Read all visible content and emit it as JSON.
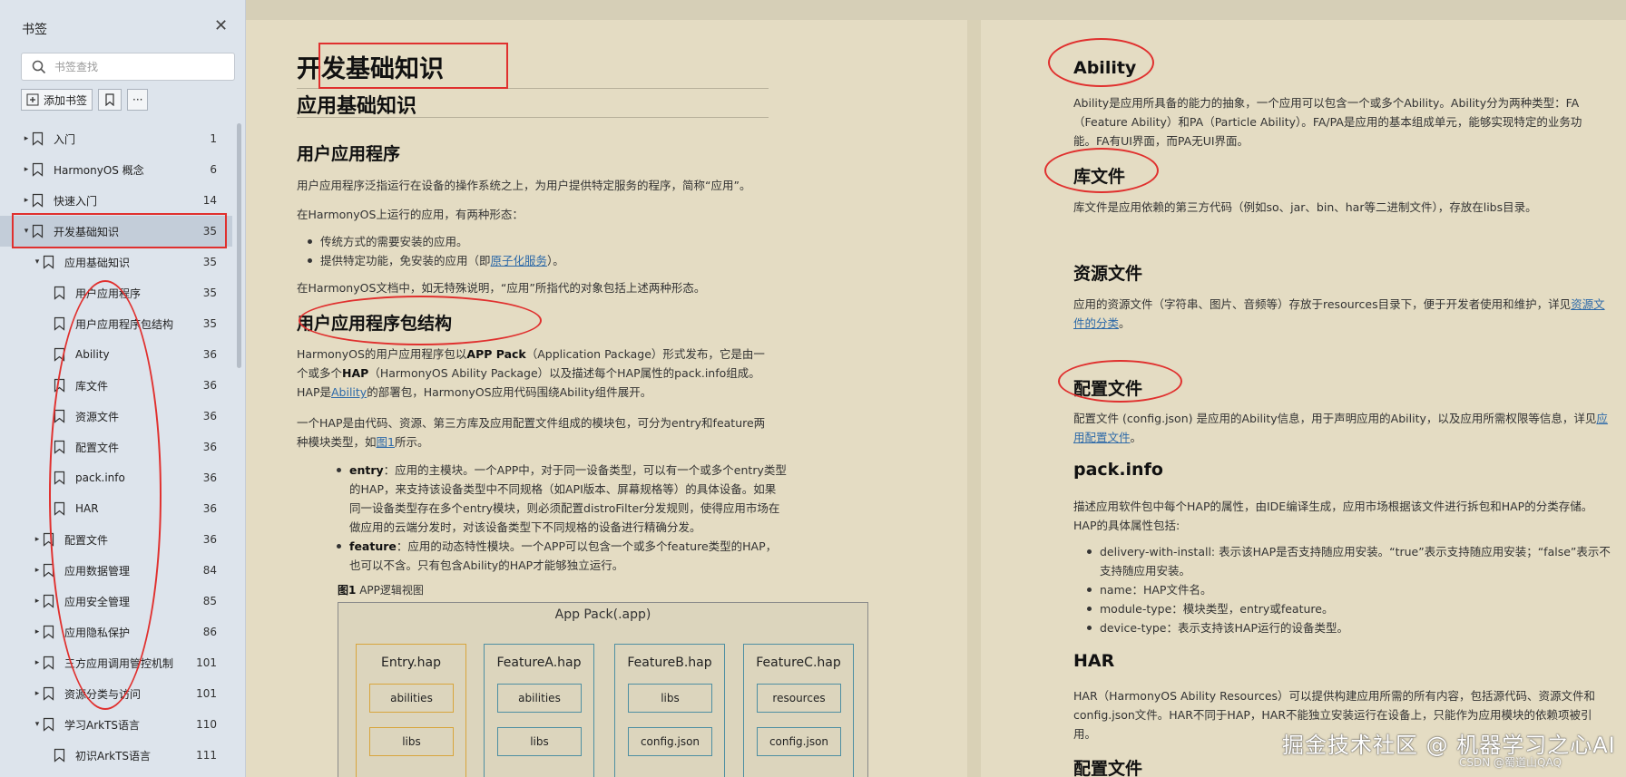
{
  "sidebar": {
    "title": "书签",
    "search_placeholder": "书签查找",
    "add_bookmark_label": "添加书签",
    "more_label": "···",
    "items": [
      {
        "label": "入门",
        "page": "1",
        "level": 0,
        "expanded": false
      },
      {
        "label": "HarmonyOS 概念",
        "page": "6",
        "level": 0,
        "expanded": false
      },
      {
        "label": "快速入门",
        "page": "14",
        "level": 0,
        "expanded": false
      },
      {
        "label": "开发基础知识",
        "page": "35",
        "level": 0,
        "expanded": true,
        "selected": true
      },
      {
        "label": "应用基础知识",
        "page": "35",
        "level": 1,
        "expanded": true
      },
      {
        "label": "用户应用程序",
        "page": "35",
        "level": 2
      },
      {
        "label": "用户应用程序包结构",
        "page": "35",
        "level": 2
      },
      {
        "label": "Ability",
        "page": "36",
        "level": 2
      },
      {
        "label": "库文件",
        "page": "36",
        "level": 2
      },
      {
        "label": "资源文件",
        "page": "36",
        "level": 2
      },
      {
        "label": "配置文件",
        "page": "36",
        "level": 2
      },
      {
        "label": "pack.info",
        "page": "36",
        "level": 2
      },
      {
        "label": "HAR",
        "page": "36",
        "level": 2
      },
      {
        "label": "配置文件",
        "page": "36",
        "level": 1,
        "expanded": false
      },
      {
        "label": "应用数据管理",
        "page": "84",
        "level": 1,
        "expanded": false
      },
      {
        "label": "应用安全管理",
        "page": "85",
        "level": 1,
        "expanded": false
      },
      {
        "label": "应用隐私保护",
        "page": "86",
        "level": 1,
        "expanded": false
      },
      {
        "label": "三方应用调用管控机制",
        "page": "101",
        "level": 1,
        "expanded": false
      },
      {
        "label": "资源分类与访问",
        "page": "101",
        "level": 1,
        "expanded": false
      },
      {
        "label": "学习ArkTS语言",
        "page": "110",
        "level": 1,
        "expanded": true
      },
      {
        "label": "初识ArkTS语言",
        "page": "111",
        "level": 2
      }
    ]
  },
  "left_page": {
    "h1": "开发基础知识",
    "h2": "应用基础知识",
    "sec1_title": "用户应用程序",
    "sec1_p1": "用户应用程序泛指运行在设备的操作系统之上，为用户提供特定服务的程序，简称“应用”。",
    "sec1_p2": "在HarmonyOS上运行的应用，有两种形态：",
    "sec1_li1": "传统方式的需要安装的应用。",
    "sec1_li2_pre": "提供特定功能，免安装的应用（即",
    "sec1_li2_link": "原子化服务",
    "sec1_li2_post": "）。",
    "sec1_p3": "在HarmonyOS文档中，如无特殊说明，“应用”所指代的对象包括上述两种形态。",
    "sec2_title": "用户应用程序包结构",
    "sec2_p1_a": "HarmonyOS的用户应用程序包以",
    "sec2_p1_b": "APP Pack",
    "sec2_p1_c": "（Application Package）形式发布，它是由一个或多个",
    "sec2_p1_d": "HAP",
    "sec2_p1_e": "（HarmonyOS Ability Package）以及描述每个HAP属性的pack.info组成。HAP是",
    "sec2_p1_link": "Ability",
    "sec2_p1_f": "的部署包，HarmonyOS应用代码围绕Ability组件展开。",
    "sec2_p2_a": "一个HAP是由代码、资源、第三方库及应用配置文件组成的模块包，可分为entry和feature两种模块类型，如",
    "sec2_p2_link": "图1",
    "sec2_p2_b": "所示。",
    "entry_term": "entry",
    "entry_text": "：应用的主模块。一个APP中，对于同一设备类型，可以有一个或多个entry类型的HAP，来支持该设备类型中不同规格（如API版本、屏幕规格等）的具体设备。如果同一设备类型存在多个entry模块，则必须配置distroFilter分发规则，使得应用市场在做应用的云端分发时，对该设备类型下不同规格的设备进行精确分发。",
    "feature_term": "feature",
    "feature_text": "：应用的动态特性模块。一个APP可以包含一个或多个feature类型的HAP，也可以不含。只有包含Ability的HAP才能够独立运行。",
    "fig_label": "图1",
    "fig_caption": "APP逻辑视图",
    "figure": {
      "title": "App Pack(.app)",
      "modules": [
        {
          "name": "Entry.hap",
          "cells": [
            "abilities",
            "libs"
          ],
          "color": "#d8a53c"
        },
        {
          "name": "FeatureA.hap",
          "cells": [
            "abilities",
            "libs"
          ],
          "color": "#4e8fa2"
        },
        {
          "name": "FeatureB.hap",
          "cells": [
            "libs",
            "config.json"
          ],
          "color": "#4e8fa2"
        },
        {
          "name": "FeatureC.hap",
          "cells": [
            "resources",
            "config.json"
          ],
          "color": "#4e8fa2"
        }
      ]
    }
  },
  "right_page": {
    "ability_title": "Ability",
    "ability_text": "Ability是应用所具备的能力的抽象，一个应用可以包含一个或多个Ability。Ability分为两种类型：FA（Feature Ability）和PA（Particle Ability）。FA/PA是应用的基本组成单元，能够实现特定的业务功能。FA有UI界面，而PA无UI界面。",
    "lib_title": "库文件",
    "lib_text": "库文件是应用依赖的第三方代码（例如so、jar、bin、har等二进制文件），存放在libs目录。",
    "res_title": "资源文件",
    "res_text_a": "应用的资源文件（字符串、图片、音频等）存放于resources目录下，便于开发者使用和维护，详见",
    "res_link": "资源文件的分类",
    "res_text_b": "。",
    "cfg_title": "配置文件",
    "cfg_text_a": "配置文件 (config.json) 是应用的Ability信息，用于声明应用的Ability，以及应用所需权限等信息，详见",
    "cfg_link": "应用配置文件",
    "cfg_text_b": "。",
    "pack_title": "pack.info",
    "pack_text1": "描述应用软件包中每个HAP的属性，由IDE编译生成，应用市场根据该文件进行拆包和HAP的分类存储。",
    "pack_text2": "HAP的具体属性包括:",
    "pack_items": [
      "delivery-with-install: 表示该HAP是否支持随应用安装。“true”表示支持随应用安装；“false”表示不支持随应用安装。",
      "name：HAP文件名。",
      "module-type：模块类型，entry或feature。",
      "device-type：表示支持该HAP运行的设备类型。"
    ],
    "har_title": "HAR",
    "har_text": "HAR（HarmonyOS Ability Resources）可以提供构建应用所需的所有内容，包括源代码、资源文件和config.json文件。HAR不同于HAP，HAR不能独立安装运行在设备上，只能作为应用模块的依赖项被引用。",
    "next_title": "配置文件"
  },
  "watermark": "掘金技术社区 @ 机器学习之心AI",
  "watermark_sub": "CSDN @蜀道山QAQ",
  "colors": {
    "annotation": "#e0302e",
    "page_bg": "#e4dcc3",
    "sidebar_bg": "#dde4ec",
    "link": "#2e6aa8"
  }
}
